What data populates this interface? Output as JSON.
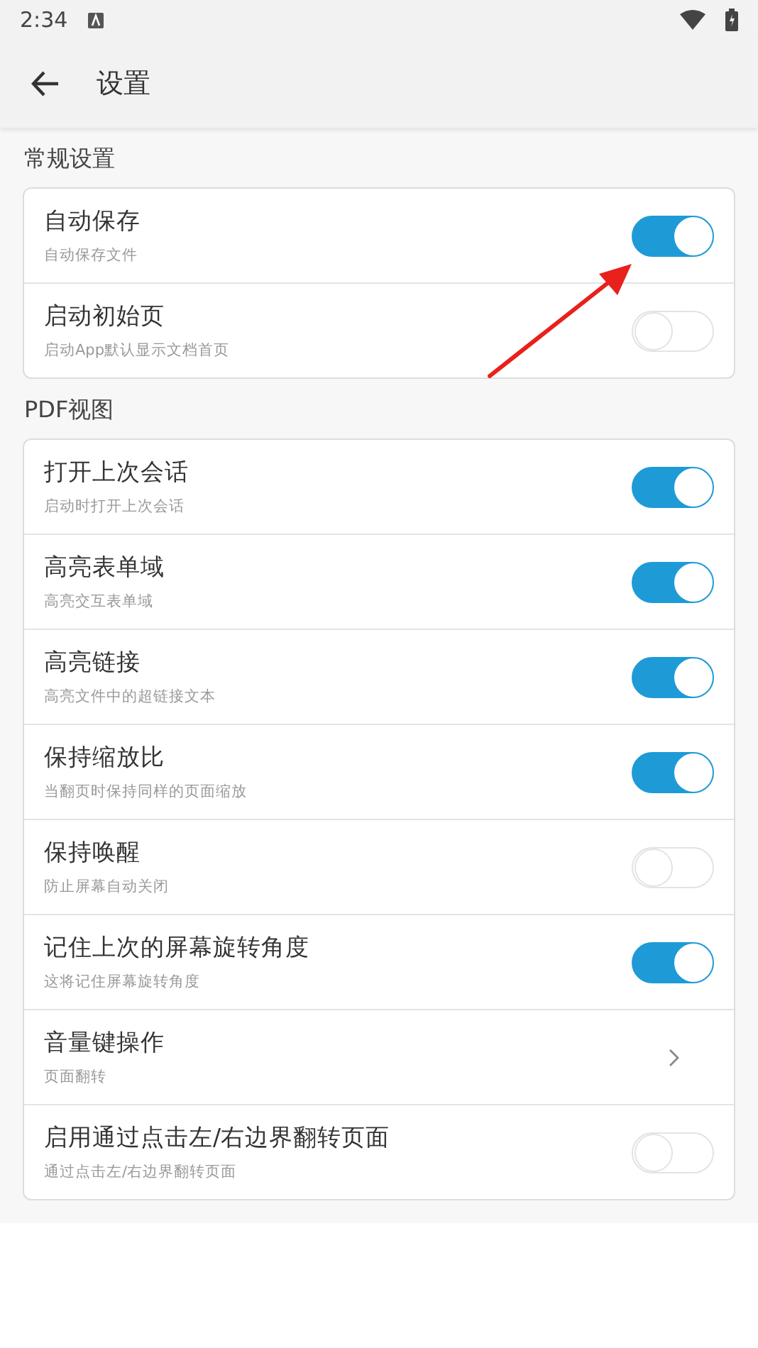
{
  "status_bar": {
    "time": "2:34"
  },
  "toolbar": {
    "title": "设置"
  },
  "sections": [
    {
      "title": "常规设置",
      "items": [
        {
          "kind": "toggle",
          "title": "自动保存",
          "subtitle": "自动保存文件",
          "on": true
        },
        {
          "kind": "toggle",
          "title": "启动初始页",
          "subtitle": "启动App默认显示文档首页",
          "on": false
        }
      ]
    },
    {
      "title": "PDF视图",
      "items": [
        {
          "kind": "toggle",
          "title": "打开上次会话",
          "subtitle": "启动时打开上次会话",
          "on": true
        },
        {
          "kind": "toggle",
          "title": "高亮表单域",
          "subtitle": "高亮交互表单域",
          "on": true
        },
        {
          "kind": "toggle",
          "title": "高亮链接",
          "subtitle": "高亮文件中的超链接文本",
          "on": true
        },
        {
          "kind": "toggle",
          "title": "保持缩放比",
          "subtitle": "当翻页时保持同样的页面缩放",
          "on": true
        },
        {
          "kind": "toggle",
          "title": "保持唤醒",
          "subtitle": "防止屏幕自动关闭",
          "on": false
        },
        {
          "kind": "toggle",
          "title": "记住上次的屏幕旋转角度",
          "subtitle": "这将记住屏幕旋转角度",
          "on": true
        },
        {
          "kind": "link",
          "title": "音量键操作",
          "subtitle": "页面翻转"
        },
        {
          "kind": "toggle",
          "title": "启用通过点击左/右边界翻转页面",
          "subtitle": "通过点击左/右边界翻转页面",
          "on": false
        }
      ]
    }
  ]
}
